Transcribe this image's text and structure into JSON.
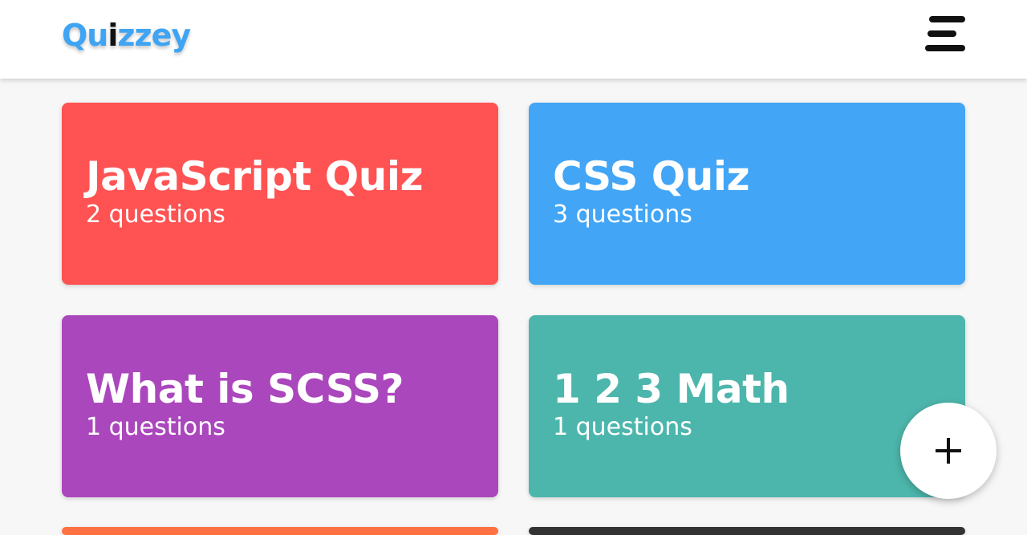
{
  "header": {
    "logo": {
      "part1": "Qu",
      "part2": "i",
      "part3": "zzey"
    },
    "menu_icon": "hamburger-menu-icon"
  },
  "quizzes": [
    {
      "title": "JavaScript Quiz",
      "subtitle": "2 questions",
      "color": "#ff5252"
    },
    {
      "title": "CSS Quiz",
      "subtitle": "3 questions",
      "color": "#42a5f5"
    },
    {
      "title": "What is SCSS?",
      "subtitle": "1 questions",
      "color": "#ab47bc"
    },
    {
      "title": "1 2 3 Math",
      "subtitle": "1 questions",
      "color": "#4db6ac"
    },
    {
      "color": "#ff7043"
    },
    {
      "color": "#333333"
    }
  ],
  "fab": {
    "icon": "plus-icon"
  }
}
